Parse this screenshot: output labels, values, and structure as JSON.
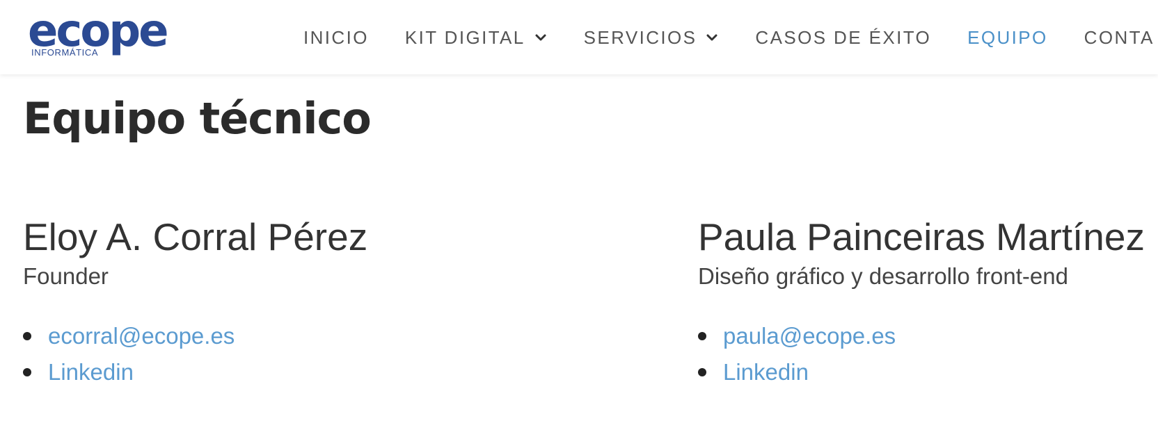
{
  "brand": {
    "logo_text": "ecope",
    "logo_subtext": "INFORMÁTICA",
    "logo_color": "#2b4a93"
  },
  "nav": {
    "items": [
      {
        "label": "INICIO",
        "has_dropdown": false,
        "active": false
      },
      {
        "label": "KIT DIGITAL",
        "has_dropdown": true,
        "active": false
      },
      {
        "label": "SERVICIOS",
        "has_dropdown": true,
        "active": false
      },
      {
        "label": "CASOS DE ÉXITO",
        "has_dropdown": false,
        "active": false
      },
      {
        "label": "EQUIPO",
        "has_dropdown": false,
        "active": true
      },
      {
        "label": "CONTA",
        "has_dropdown": false,
        "active": false
      }
    ],
    "active_color": "#4a90c8",
    "text_color": "#555555"
  },
  "page": {
    "title": "Equipo técnico"
  },
  "team": [
    {
      "name": "Eloy A. Corral Pérez",
      "role": "Founder",
      "links": [
        "ecorral@ecope.es",
        "Linkedin"
      ]
    },
    {
      "name": "Paula Painceiras Martínez",
      "role": "Diseño gráfico y desarrollo front-end",
      "links": [
        "paula@ecope.es",
        "Linkedin"
      ]
    }
  ],
  "colors": {
    "link": "#5b9bd0",
    "heading": "#2b2b2b"
  }
}
